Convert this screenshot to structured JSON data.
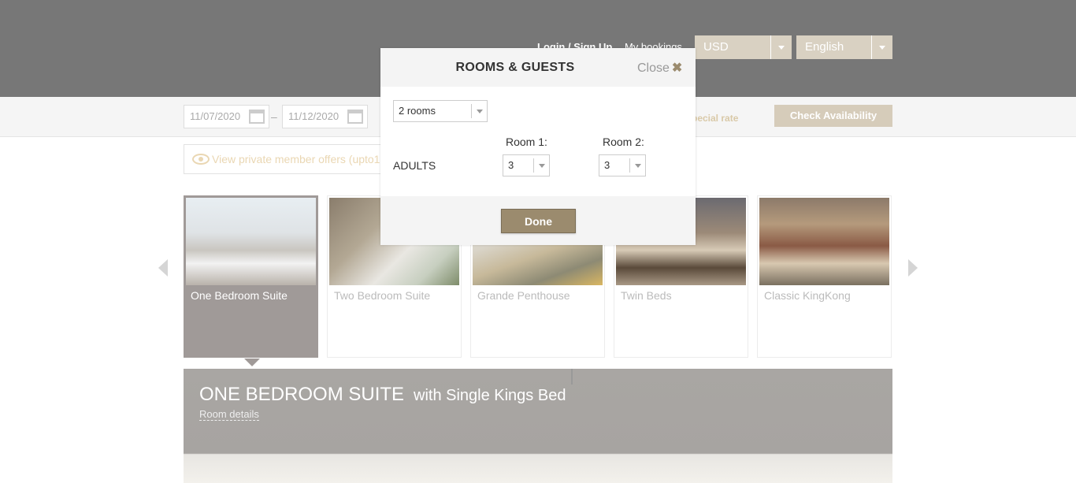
{
  "header": {
    "login_label": "Login / Sign Up",
    "bookings_label": "My bookings",
    "currency": "USD",
    "language": "English"
  },
  "search": {
    "checkin": "11/07/2020",
    "checkout": "11/12/2020",
    "date_separator": "–",
    "special_rate_label": "pecial rate",
    "check_label": "Check Availability"
  },
  "offers": {
    "label": "View private member offers (upto1"
  },
  "rooms": [
    {
      "name": "One Bedroom Suite",
      "active": true
    },
    {
      "name": "Two Bedroom Suite",
      "active": false
    },
    {
      "name": "Grande Penthouse",
      "active": false
    },
    {
      "name": "Twin Beds",
      "active": false
    },
    {
      "name": "Classic KingKong",
      "active": false
    }
  ],
  "featured": {
    "title": "ONE BEDROOM SUITE",
    "subtitle": "with Single Kings Bed",
    "details_label": "Room details"
  },
  "modal": {
    "title": "ROOMS & GUESTS",
    "close_label": "Close",
    "close_icon": "✖",
    "rooms_value": "2 rooms",
    "room1_label": "Room 1:",
    "room2_label": "Room 2:",
    "adults_label": "ADULTS",
    "room1_adults": "3",
    "room2_adults": "3",
    "done_label": "Done"
  },
  "colors": {
    "header_bg": "#777777",
    "accent": "#9b8b6e",
    "active_card": "#a09a98"
  }
}
